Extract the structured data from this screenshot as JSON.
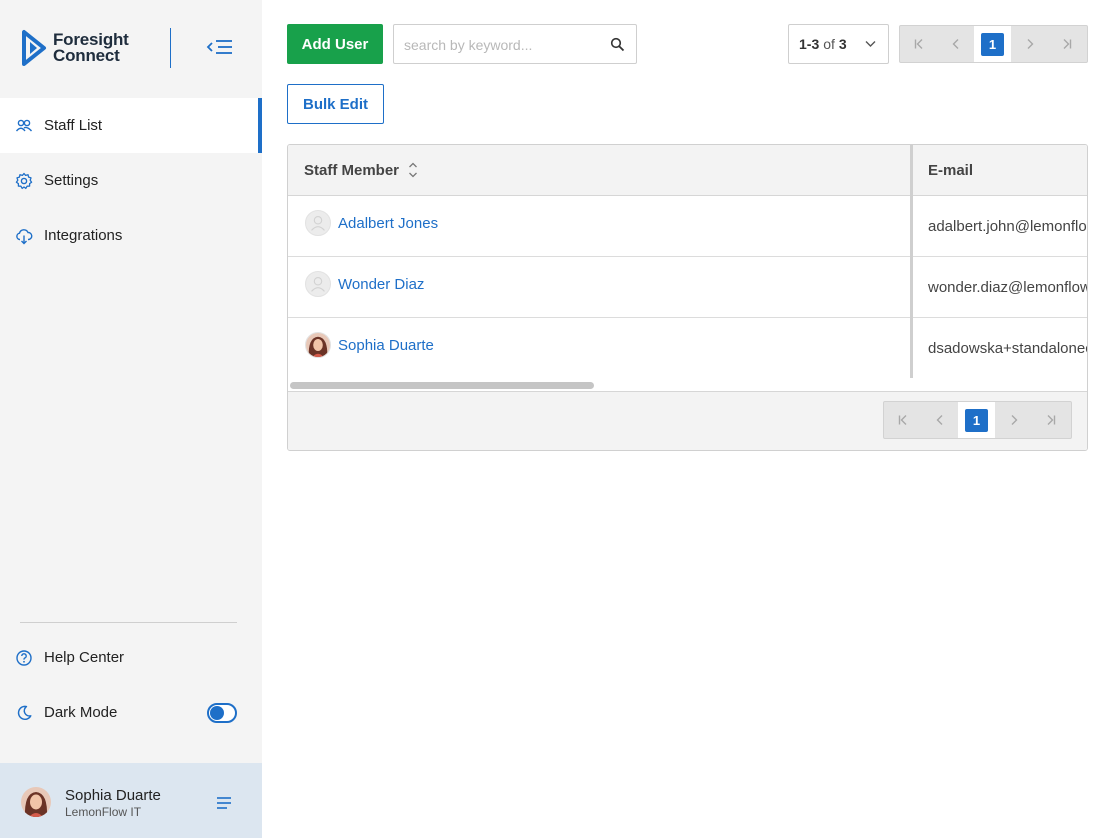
{
  "brand": {
    "line1": "Foresight",
    "line2": "Connect",
    "color": "#1e6fc8"
  },
  "sidebar": {
    "items": [
      {
        "label": "Staff List",
        "icon": "users-icon",
        "active": true
      },
      {
        "label": "Settings",
        "icon": "gear-icon"
      },
      {
        "label": "Integrations",
        "icon": "cloud-download-icon"
      }
    ],
    "bottom": [
      {
        "label": "Help Center",
        "icon": "help-icon"
      },
      {
        "label": "Dark Mode",
        "icon": "moon-icon"
      }
    ],
    "dark_mode_on": true
  },
  "user": {
    "name": "Sophia Duarte",
    "org": "LemonFlow IT"
  },
  "toolbar": {
    "add_user": "Add User",
    "search_placeholder": "search by keyword...",
    "search_value": "",
    "bulk_edit": "Bulk Edit",
    "range": {
      "start_end": "1-3",
      "of": "of",
      "total": "3"
    },
    "current_page": "1"
  },
  "table": {
    "headers": {
      "name": "Staff Member",
      "email": "E-mail"
    },
    "rows": [
      {
        "name": "Adalbert Jones",
        "email": "adalbert.john@lemonflo",
        "avatar": "placeholder"
      },
      {
        "name": "Wonder Diaz",
        "email": "wonder.diaz@lemonflow",
        "avatar": "placeholder"
      },
      {
        "name": "Sophia Duarte",
        "email": "dsadowska+standalonec",
        "avatar": "photo"
      }
    ],
    "footer_page": "1"
  },
  "colors": {
    "accent": "#1e6fc8",
    "success": "#18a14b",
    "sidebar_bg": "#f4f4f4",
    "user_bg": "#dce6f0"
  }
}
